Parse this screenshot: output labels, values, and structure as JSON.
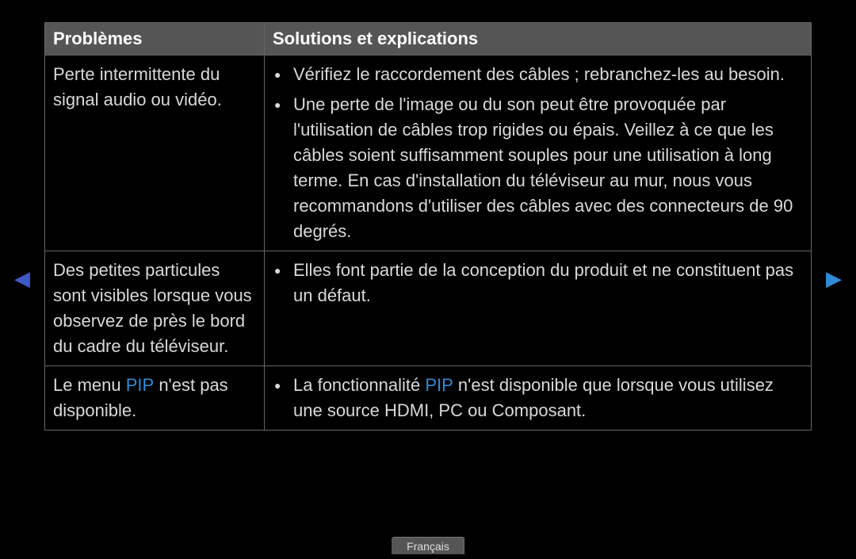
{
  "header": {
    "problems": "Problèmes",
    "solutions": "Solutions et explications"
  },
  "rows": [
    {
      "problem": "Perte intermittente du signal audio ou vidéo.",
      "solutions": [
        "Vérifiez le raccordement des câbles ; rebranchez-les au besoin.",
        "Une perte de l'image ou du son peut être provoquée par l'utilisation de câbles trop rigides ou épais. Veillez à ce que les câbles soient suffisamment souples pour une utilisation à long terme. En cas d'installation du téléviseur au mur, nous vous recommandons d'utiliser des câbles avec des connecteurs de 90 degrés."
      ]
    },
    {
      "problem": "Des petites particules sont visibles lorsque vous observez de près le bord du cadre du téléviseur.",
      "solutions": [
        "Elles font partie de la conception du produit et ne constituent pas un défaut."
      ]
    },
    {
      "problem_parts": [
        "Le menu ",
        "PIP",
        " n'est pas disponible."
      ],
      "solution_parts": [
        "La fonctionnalité ",
        "PIP",
        " n'est disponible que lorsque vous utilisez une source HDMI, PC ou Composant."
      ]
    }
  ],
  "language_tab": "Français",
  "nav": {
    "prev": "◀",
    "next": "▶"
  }
}
